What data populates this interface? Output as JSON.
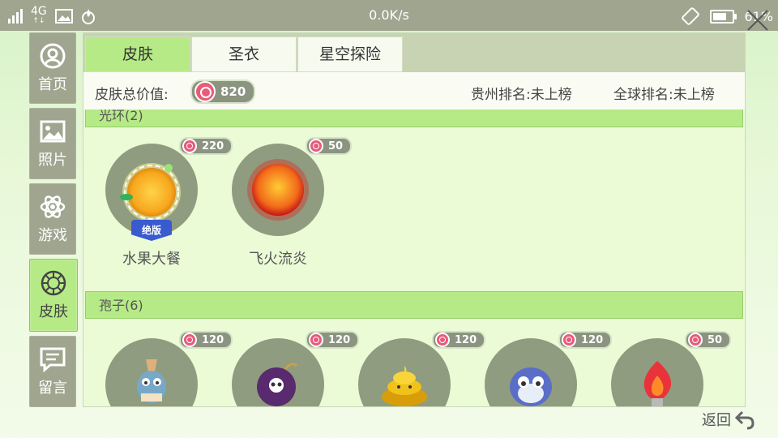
{
  "status_bar": {
    "network": "4G",
    "network_arrows": "↑↓",
    "speed": "0.0K/s",
    "battery": "61%",
    "battery_level": 0.61
  },
  "nav": [
    {
      "label": "首页",
      "icon": "user-circle-icon"
    },
    {
      "label": "照片",
      "icon": "photo-icon"
    },
    {
      "label": "游戏",
      "icon": "atom-icon"
    },
    {
      "label": "皮肤",
      "icon": "skin-wheel-icon",
      "active": true
    },
    {
      "label": "留言",
      "icon": "message-icon"
    }
  ],
  "tabs": [
    {
      "label": "皮肤",
      "active": true
    },
    {
      "label": "圣衣"
    },
    {
      "label": "星空探险"
    }
  ],
  "info": {
    "total_label": "皮肤总价值:",
    "total_value": "820",
    "rank_province": "贵州排名:未上榜",
    "rank_global": "全球排名:未上榜"
  },
  "sections": [
    {
      "title": "光环(2)",
      "items": [
        {
          "name": "水果大餐",
          "price": "220",
          "badge": "绝版"
        },
        {
          "name": "飞火流炎",
          "price": "50"
        }
      ]
    },
    {
      "title": "孢子(6)",
      "items": [
        {
          "price": "120"
        },
        {
          "price": "120"
        },
        {
          "price": "120"
        },
        {
          "price": "120"
        },
        {
          "price": "50"
        }
      ]
    }
  ],
  "back_label": "返回"
}
